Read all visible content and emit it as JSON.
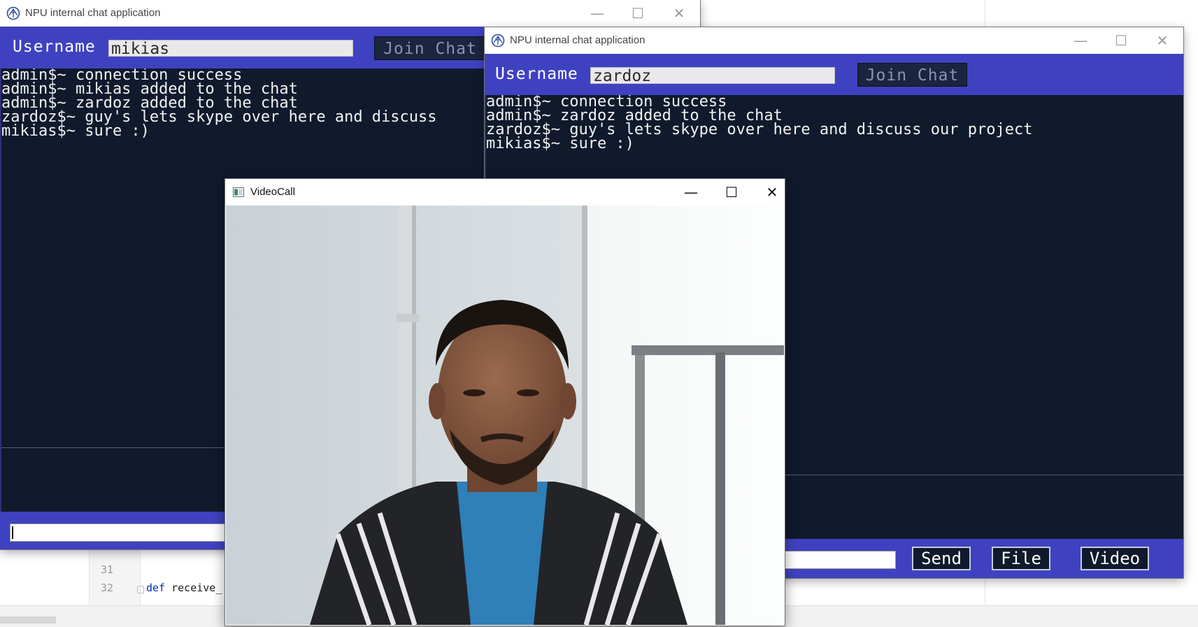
{
  "ide": {
    "line_numbers": [
      "31",
      "32"
    ],
    "code_keyword": "def",
    "code_text": " receive_"
  },
  "chat_window_1": {
    "title": "NPU internal chat application",
    "username_label": "Username",
    "username_value": "mikias",
    "join_label": "Join Chat",
    "messages": [
      "admin$~ connection success",
      "admin$~ mikias added to the chat",
      "admin$~ zardoz added to the chat",
      "zardoz$~ guy's lets skype over here and discuss",
      "mikias$~ sure :)"
    ]
  },
  "chat_window_2": {
    "title": "NPU internal chat application",
    "username_label": "Username",
    "username_value": "zardoz",
    "join_label": "Join Chat",
    "messages": [
      "admin$~ connection success",
      "admin$~ zardoz added to the chat",
      "zardoz$~ guy's lets skype over here and discuss our project",
      "mikias$~ sure :)"
    ],
    "send_label": "Send",
    "file_label": "File",
    "video_label": "Video"
  },
  "video_window": {
    "title": "VideoCall"
  },
  "window_controls": {
    "minimize": "—",
    "maximize": "☐",
    "close": "✕"
  },
  "colors": {
    "chat_background": "#101a2c",
    "band_blue": "#3f42c0",
    "join_button": "#1b2540"
  }
}
